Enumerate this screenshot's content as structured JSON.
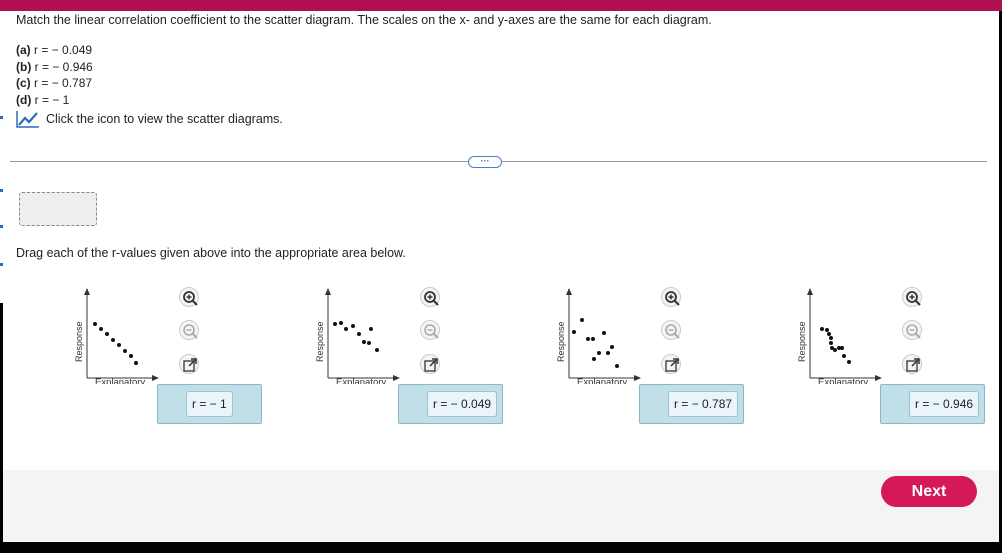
{
  "question": "Match the linear correlation coefficient to the scatter diagram. The scales on the x- and y-axes are the same for each diagram.",
  "options": [
    {
      "label": "(a)",
      "text": "r = − 0.049"
    },
    {
      "label": "(b)",
      "text": "r = − 0.946"
    },
    {
      "label": "(c)",
      "text": "r = − 0.787"
    },
    {
      "label": "(d)",
      "text": "r = − 1"
    }
  ],
  "icon_link": {
    "icon": "line-chart-icon",
    "text": "Click the icon to view the scatter diagrams."
  },
  "divider_handle": "···",
  "instruction": "Drag each of the r-values given above into the appropriate area below.",
  "diagrams": [
    {
      "xlabel": "Explanatory",
      "ylabel": "Response",
      "answer": "r = − 1"
    },
    {
      "xlabel": "Explanatory",
      "ylabel": "Response",
      "answer": "r = − 0.049"
    },
    {
      "xlabel": "Explanatory",
      "ylabel": "Response",
      "answer": "r = − 0.787"
    },
    {
      "xlabel": "Explanatory",
      "ylabel": "Response",
      "answer": "r = − 0.946"
    }
  ],
  "zoom_icons": [
    "zoom-in-icon",
    "zoom-out-icon",
    "popout-icon"
  ],
  "next_label": "Next",
  "colors": {
    "accent": "#b01050",
    "next": "#d4185a",
    "answer_box": "#c0dfe9"
  }
}
